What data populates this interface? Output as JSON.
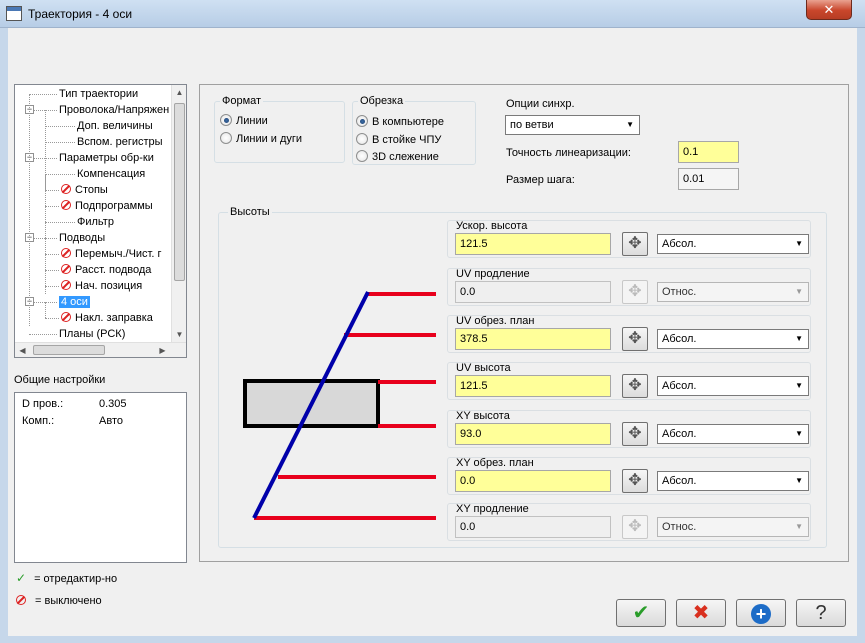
{
  "window": {
    "title": "Траектория - 4 оси",
    "close_glyph": "✕"
  },
  "tree": {
    "items": [
      {
        "label": "Тип траектории",
        "icon": ""
      },
      {
        "label": "Проволока/Напряжен",
        "icon": ""
      },
      {
        "label": "Доп. величины",
        "icon": ""
      },
      {
        "label": "Вспом. регистры",
        "icon": ""
      },
      {
        "label": "Параметры обр-ки",
        "icon": ""
      },
      {
        "label": "Компенсация",
        "icon": ""
      },
      {
        "label": "Стопы",
        "icon": "disabled-icon"
      },
      {
        "label": "Подпрограммы",
        "icon": "disabled-icon"
      },
      {
        "label": "Фильтр",
        "icon": ""
      },
      {
        "label": "Подводы",
        "icon": ""
      },
      {
        "label": "Перемыч./Чист. г",
        "icon": "disabled-icon"
      },
      {
        "label": "Расст. подвода",
        "icon": "disabled-icon"
      },
      {
        "label": "Нач. позиция",
        "icon": "disabled-icon"
      },
      {
        "label": "4 оси",
        "icon": "",
        "selected": true
      },
      {
        "label": "Накл. заправка",
        "icon": "disabled-icon"
      },
      {
        "label": "Планы (РСК)",
        "icon": ""
      }
    ]
  },
  "general": {
    "title": "Общие настройки",
    "rows": [
      {
        "key": "D пров.:",
        "value": "0.305"
      },
      {
        "key": "Комп.:",
        "value": "Авто"
      }
    ]
  },
  "legend": {
    "edited": "= отредактир-но",
    "disabled": "= выключено"
  },
  "format": {
    "title": "Формат",
    "options": [
      "Линии",
      "Линии и дуги"
    ],
    "selected": 0
  },
  "trim": {
    "title": "Обрезка",
    "options": [
      "В компьютере",
      "В стойке ЧПУ",
      "3D слежение"
    ],
    "selected": 0
  },
  "sync": {
    "label": "Опции синхр.",
    "value": "по ветви",
    "accuracy_label": "Точность линеаризации:",
    "accuracy_value": "0.1",
    "step_label": "Размер шага:",
    "step_value": "0.01"
  },
  "heights": {
    "title": "Высоты",
    "rows": [
      {
        "label": "Ускор. высота",
        "value": "121.5",
        "mode": "Абсол.",
        "enabled": true
      },
      {
        "label": "UV продление",
        "value": "0.0",
        "mode": "Относ.",
        "enabled": false
      },
      {
        "label": "UV обрез. план",
        "value": "378.5",
        "mode": "Абсол.",
        "enabled": true
      },
      {
        "label": "UV высота",
        "value": "121.5",
        "mode": "Абсол.",
        "enabled": true
      },
      {
        "label": "XY высота",
        "value": "93.0",
        "mode": "Абсол.",
        "enabled": true
      },
      {
        "label": "XY обрез. план",
        "value": "0.0",
        "mode": "Абсол.",
        "enabled": true
      },
      {
        "label": "XY продление",
        "value": "0.0",
        "mode": "Относ.",
        "enabled": false
      }
    ]
  },
  "buttons": {
    "ok": "✔",
    "cancel": "✖",
    "add": "+",
    "help": "?"
  },
  "colors": {
    "edit_bg": "#ffff99",
    "diagram_line": "#0000aa",
    "diagram_mark": "#e8001c",
    "ok": "#2a9d2a",
    "cancel": "#d9301f",
    "add": "#1d6cc7"
  }
}
